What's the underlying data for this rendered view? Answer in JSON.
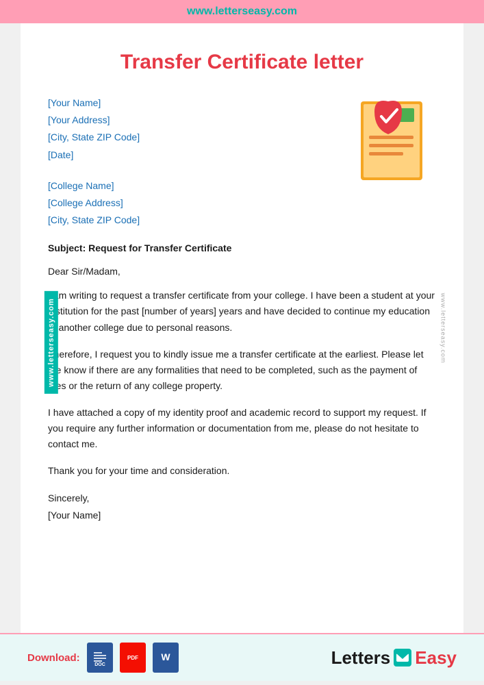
{
  "header": {
    "website_url": "www.letterseasy.com",
    "background_color": "#ff9eb5",
    "link_color": "#00b8a9"
  },
  "side_label_left": "www.letterseasy.com",
  "side_label_right": "www.letterseasy.com",
  "page_title": "Transfer Certificate letter",
  "letter": {
    "sender": {
      "line1": "[Your Name]",
      "line2": "[Your Address]",
      "line3": "[City, State ZIP Code]",
      "line4": "[Date]"
    },
    "recipient": {
      "line1": "[College Name]",
      "line2": "[College Address]",
      "line3": "[City, State ZIP Code]"
    },
    "subject": "Subject: Request for Transfer Certificate",
    "salutation": "Dear Sir/Madam,",
    "body_para1": "I am writing to request a transfer certificate from your college. I have been a student at your institution for the past [number of years] years and have decided to continue my education at another college due to personal reasons.",
    "body_para2": "Therefore, I request you to kindly issue me a transfer certificate at the earliest. Please let me know if there are any formalities that need to be completed, such as the payment of fees or the return of any college property.",
    "body_para3": "I have attached a copy of my identity proof and academic record to support my request. If you require any further information or documentation from me, please do not hesitate to contact me.",
    "body_para4": "Thank you for your time and consideration.",
    "closing": "Sincerely,",
    "sender_name": "[Your Name]"
  },
  "footer": {
    "download_label": "Download:",
    "icons": [
      {
        "type": "doc",
        "label": "DOC"
      },
      {
        "type": "pdf",
        "label": "PDF"
      },
      {
        "type": "word",
        "label": "W"
      }
    ],
    "brand": {
      "text_black": "Letters",
      "text_red": "Easy"
    }
  }
}
